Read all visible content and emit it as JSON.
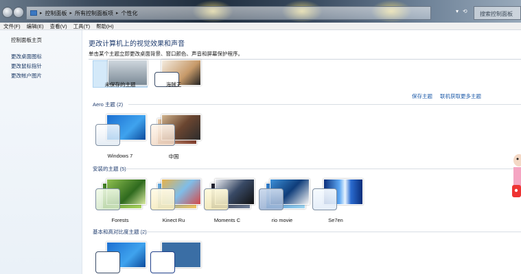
{
  "window": {
    "breadcrumbs": [
      "控制面板",
      "所有控制面板项",
      "个性化"
    ],
    "search_placeholder": "搜索控制面板"
  },
  "menubar": [
    "文件(F)",
    "编辑(E)",
    "查看(V)",
    "工具(T)",
    "帮助(H)"
  ],
  "sidebar": {
    "home": "控制面板主页",
    "links": [
      "更改桌面图标",
      "更改鼠标指针",
      "更改帐户图片"
    ]
  },
  "main": {
    "title": "更改计算机上的视觉效果和声音",
    "subtitle": "单击某个主题立即更改桌面背景、窗口颜色、声音和屏幕保护程序。",
    "my_themes": [
      {
        "label": "未保存的主题",
        "selected": true
      },
      {
        "label": "海贼王",
        "selected": false
      }
    ],
    "save_theme": "保存主题",
    "get_more": "联机获取更多主题",
    "groups": [
      {
        "title": "Aero 主题 (2)",
        "themes": [
          "Windows 7",
          "中国"
        ]
      },
      {
        "title": "安装的主题 (5)",
        "themes": [
          "Forests",
          "Kinect Ru",
          "Moments C",
          "rio movie",
          "Se7en"
        ]
      },
      {
        "title": "基本和高对比度主题 (2)",
        "themes": []
      }
    ]
  },
  "colors": {
    "link": "#1c5aa8",
    "heading": "#1e3b6e",
    "selected": "#d4e9f9"
  }
}
